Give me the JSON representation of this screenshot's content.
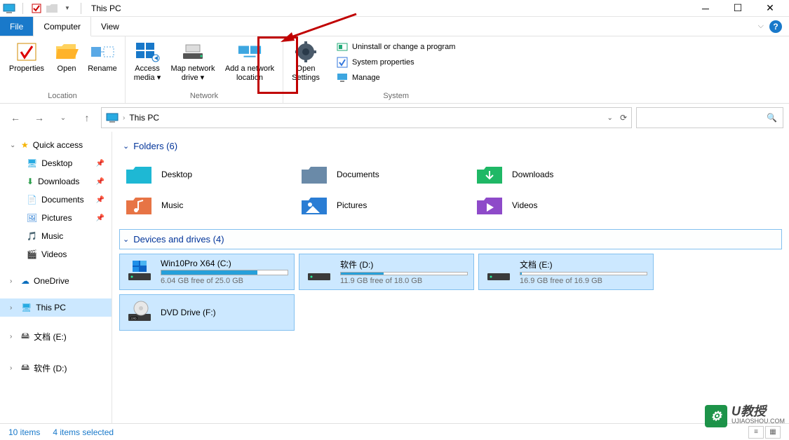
{
  "title": "This PC",
  "tabs": {
    "file": "File",
    "computer": "Computer",
    "view": "View"
  },
  "ribbon": {
    "location": {
      "label": "Location",
      "properties": "Properties",
      "open": "Open",
      "rename": "Rename"
    },
    "network": {
      "label": "Network",
      "access_media": "Access media ▾",
      "map_drive": "Map network drive ▾",
      "add_location": "Add a network location"
    },
    "open_settings": {
      "label1": "Open",
      "label2": "Settings"
    },
    "system": {
      "label": "System",
      "uninstall": "Uninstall or change a program",
      "props": "System properties",
      "manage": "Manage"
    }
  },
  "address": {
    "location": "This PC"
  },
  "sidebar": {
    "quick_access": "Quick access",
    "desktop": "Desktop",
    "downloads": "Downloads",
    "documents": "Documents",
    "pictures": "Pictures",
    "music": "Music",
    "videos": "Videos",
    "onedrive": "OneDrive",
    "this_pc": "This PC",
    "drive_e": "文档 (E:)",
    "drive_d": "软件 (D:)"
  },
  "sections": {
    "folders": "Folders (6)",
    "drives": "Devices and drives (4)"
  },
  "folders": {
    "desktop": "Desktop",
    "documents": "Documents",
    "downloads": "Downloads",
    "music": "Music",
    "pictures": "Pictures",
    "videos": "Videos"
  },
  "drives": {
    "c": {
      "name": "Win10Pro X64 (C:)",
      "free": "6.04 GB free of 25.0 GB",
      "pct": 76
    },
    "d": {
      "name": "软件 (D:)",
      "free": "11.9 GB free of 18.0 GB",
      "pct": 34
    },
    "e": {
      "name": "文档 (E:)",
      "free": "16.9 GB free of 16.9 GB",
      "pct": 1
    },
    "f": {
      "name": "DVD Drive (F:)"
    }
  },
  "status": {
    "items": "10 items",
    "selected": "4 items selected"
  },
  "watermark": {
    "main": "U教授",
    "sub": "UJIAOSHOU.COM"
  }
}
